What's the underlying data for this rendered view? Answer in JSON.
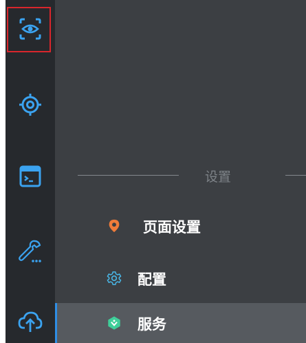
{
  "rail": {
    "items": [
      {
        "name": "eye-scan-icon",
        "active": true
      },
      {
        "name": "target-icon",
        "active": false
      },
      {
        "name": "terminal-icon",
        "active": false
      },
      {
        "name": "wrench-more-icon",
        "active": false
      },
      {
        "name": "cloud-upload-icon",
        "active": false
      }
    ]
  },
  "panel": {
    "section_title": "设置",
    "items": [
      {
        "label": "页面设置",
        "icon": "location-pin-icon",
        "icon_color": "#f07c3a"
      },
      {
        "label": "配置",
        "icon": "gear-icon",
        "icon_color": "#49b8e8"
      },
      {
        "label": "服务",
        "icon": "service-hex-icon",
        "icon_color": "#3fcf9a"
      }
    ],
    "selected_index": 2
  },
  "colors": {
    "rail_bg": "#26292d",
    "panel_bg": "#3c3f43",
    "icon_blue": "#3ba3f0",
    "active_border": "#d9262c",
    "selected_bg": "#565a5f",
    "selected_accent": "#2f8ee6"
  }
}
